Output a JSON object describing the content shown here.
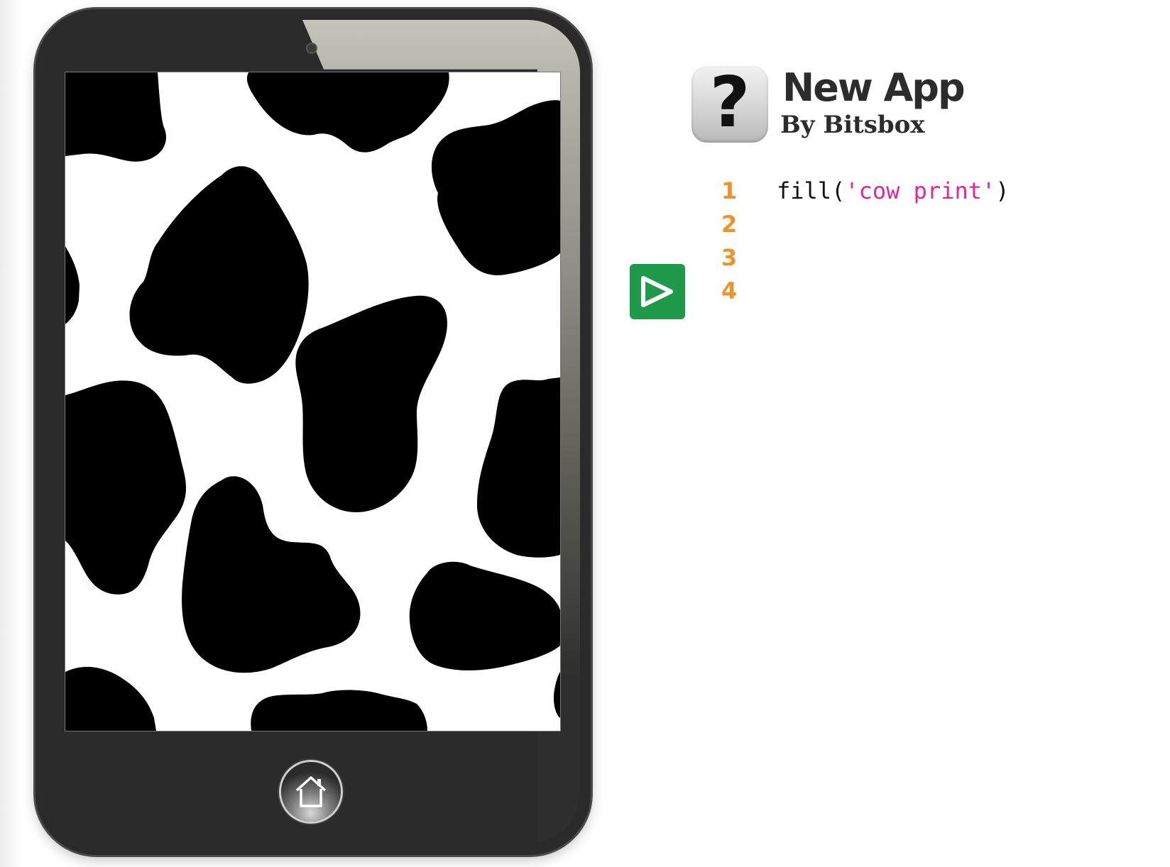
{
  "app": {
    "title": "New App",
    "author": "By Bitsbox",
    "icon_glyph": "?"
  },
  "editor": {
    "lines": [
      {
        "number": "1",
        "func": "fill",
        "open": "(",
        "string": "'cow print'",
        "close": ")"
      },
      {
        "number": "2",
        "code": ""
      },
      {
        "number": "3",
        "code": ""
      },
      {
        "number": "4",
        "code": ""
      }
    ]
  },
  "controls": {
    "run_icon": "play-icon",
    "home_icon": "home-icon"
  },
  "screen": {
    "fill": "cow print"
  },
  "colors": {
    "run_button": "#1f9a4a",
    "line_numbers": "#f0922a",
    "string": "#e0279a",
    "phone_body": "#2a2a2a"
  }
}
